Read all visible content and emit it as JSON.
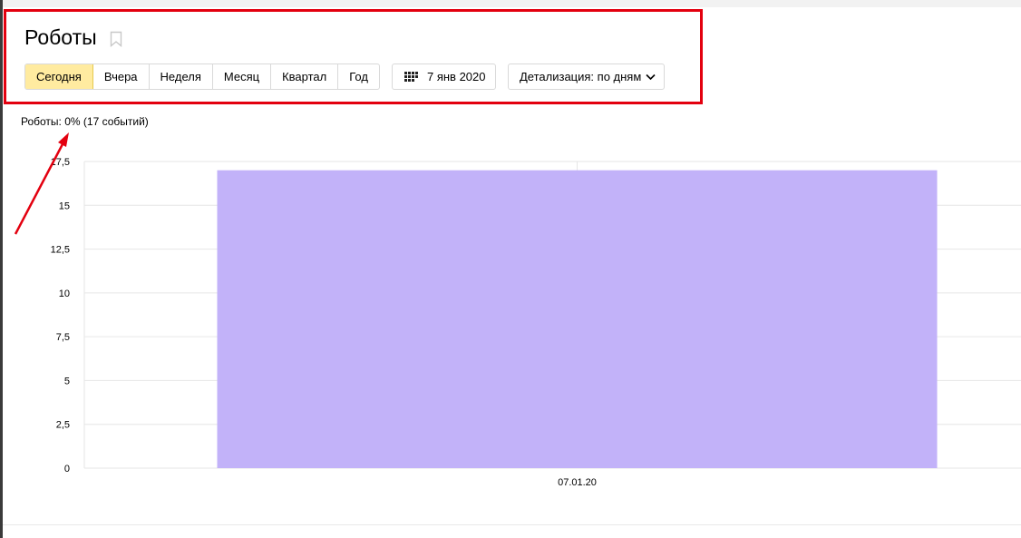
{
  "page": {
    "title": "Роботы"
  },
  "periods": [
    {
      "label": "Сегодня",
      "active": true
    },
    {
      "label": "Вчера",
      "active": false
    },
    {
      "label": "Неделя",
      "active": false
    },
    {
      "label": "Месяц",
      "active": false
    },
    {
      "label": "Квартал",
      "active": false
    },
    {
      "label": "Год",
      "active": false
    }
  ],
  "date_picker": {
    "label": "7 янв 2020",
    "icon": "calendar-icon"
  },
  "detail": {
    "label": "Детализация: по дням",
    "icon": "chevron-down-icon"
  },
  "summary": {
    "text": "Роботы: 0% (17 событий)"
  },
  "colors": {
    "accent_active": "#ffeba0",
    "bar": "#c2b2f9",
    "annotation": "#e3000f"
  },
  "chart_data": {
    "type": "bar",
    "categories": [
      "07.01.20"
    ],
    "values": [
      17
    ],
    "ylim": [
      0,
      17.5
    ],
    "yticks": [
      "0",
      "2,5",
      "5",
      "7,5",
      "10",
      "12,5",
      "15",
      "17,5"
    ],
    "grid": true,
    "title": "",
    "xlabel": "",
    "ylabel": ""
  }
}
